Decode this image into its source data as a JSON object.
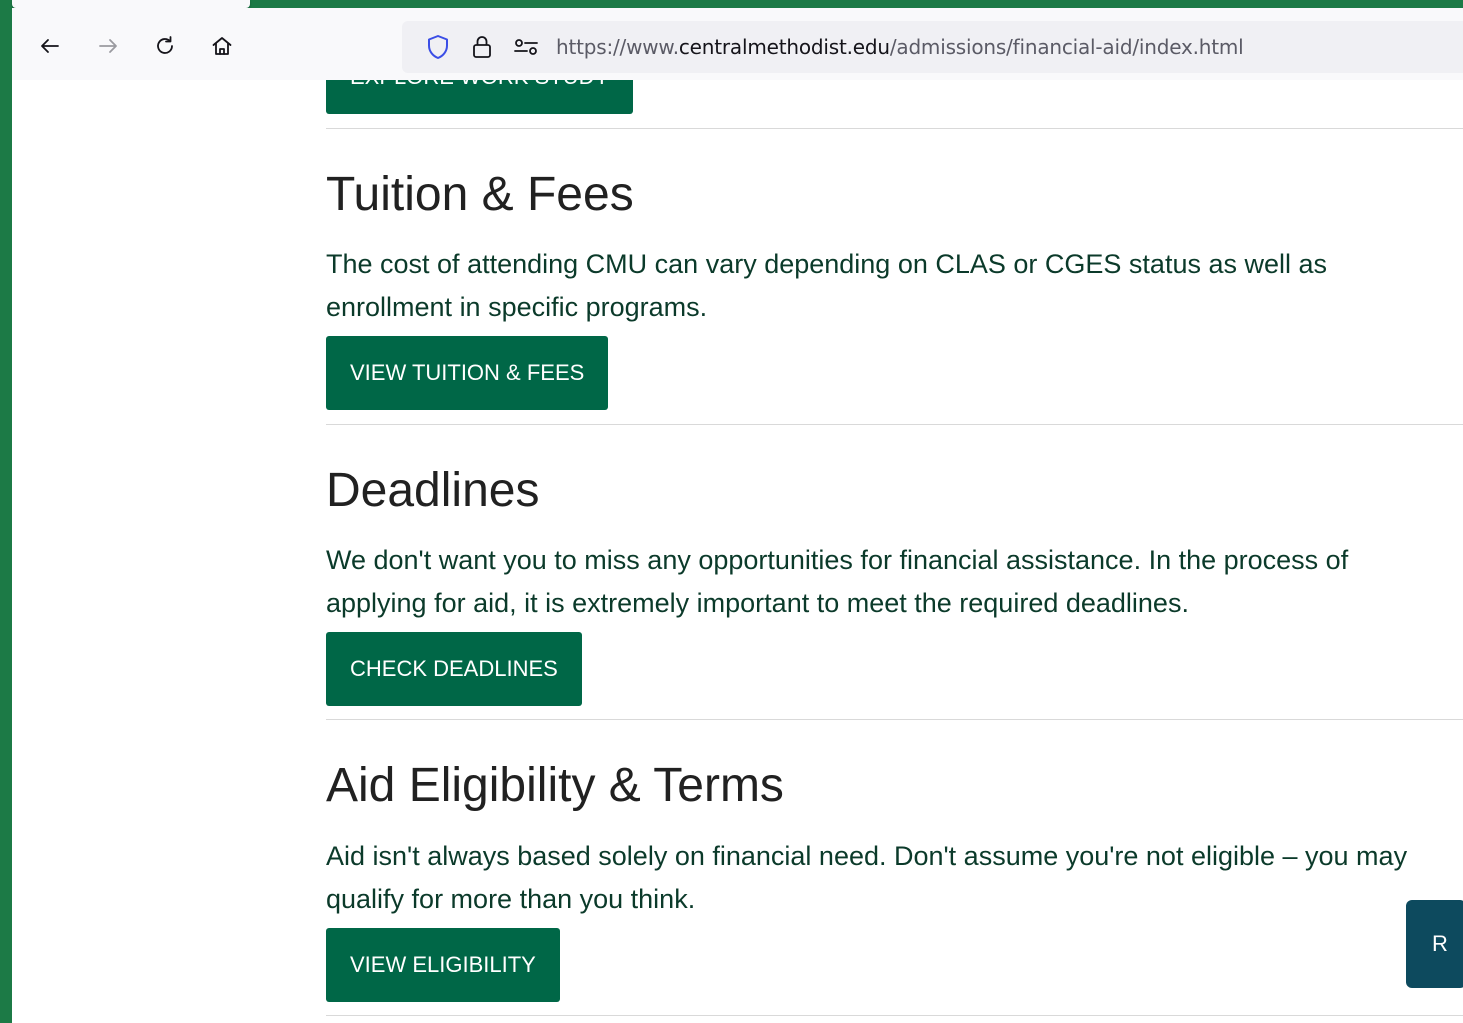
{
  "browser": {
    "url_prefix": "https://www.",
    "url_domain": "centralmethodist.edu",
    "url_path": "/admissions/financial-aid/index.html"
  },
  "sections": {
    "work_study": {
      "button": "EXPLORE WORK STUDY"
    },
    "tuition": {
      "heading": "Tuition & Fees",
      "text": "The cost of attending CMU can vary depending on CLAS or CGES status as well as enrollment in specific programs.",
      "button": "VIEW TUITION & FEES"
    },
    "deadlines": {
      "heading": "Deadlines",
      "text": "We don't want you to miss any opportunities for financial assistance. In the process of applying for aid, it is extremely important to meet the required deadlines.",
      "button": "CHECK DEADLINES"
    },
    "eligibility": {
      "heading": "Aid Eligibility & Terms",
      "text": "Aid isn't always based solely on financial need. Don't assume you're not eligible – you may qualify for more than you think.",
      "button": "VIEW ELIGIBILITY"
    }
  },
  "floating_button": {
    "label": "R"
  },
  "colors": {
    "brand_green": "#006747",
    "frame_green": "#1c7a46",
    "floating_button": "#0d4a5e"
  },
  "icons": [
    "back-arrow-icon",
    "forward-arrow-icon",
    "reload-icon",
    "home-icon",
    "shield-icon",
    "lock-icon",
    "permissions-icon"
  ]
}
